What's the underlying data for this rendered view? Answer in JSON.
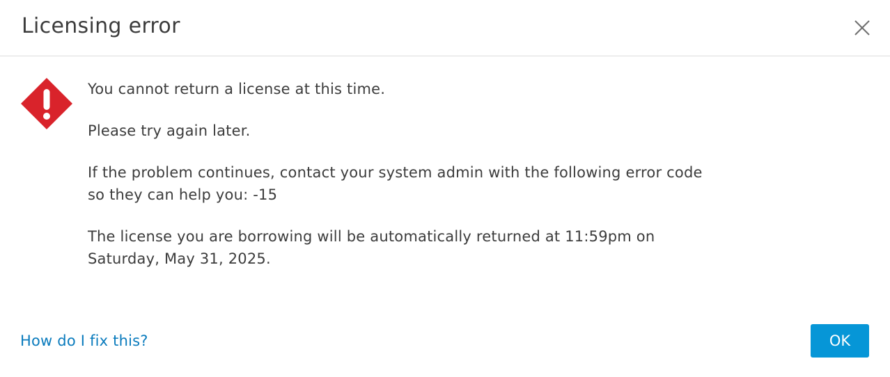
{
  "dialog": {
    "title": "Licensing error",
    "close_icon": "close-icon",
    "error_icon": "error-diamond-icon",
    "messages": [
      "You cannot return a license at this time.",
      "Please try again later.",
      "If the problem continues, contact your system admin with the following error code so they can help you: -15",
      "The license you are borrowing will be automatically returned at 11:59pm on Saturday, May 31, 2025."
    ],
    "help_link": "How do I fix this?",
    "ok_label": "OK"
  },
  "colors": {
    "error_red": "#d9232b",
    "link_blue": "#0a7bbd",
    "button_blue": "#0696d7",
    "text": "#3c3c3c"
  }
}
